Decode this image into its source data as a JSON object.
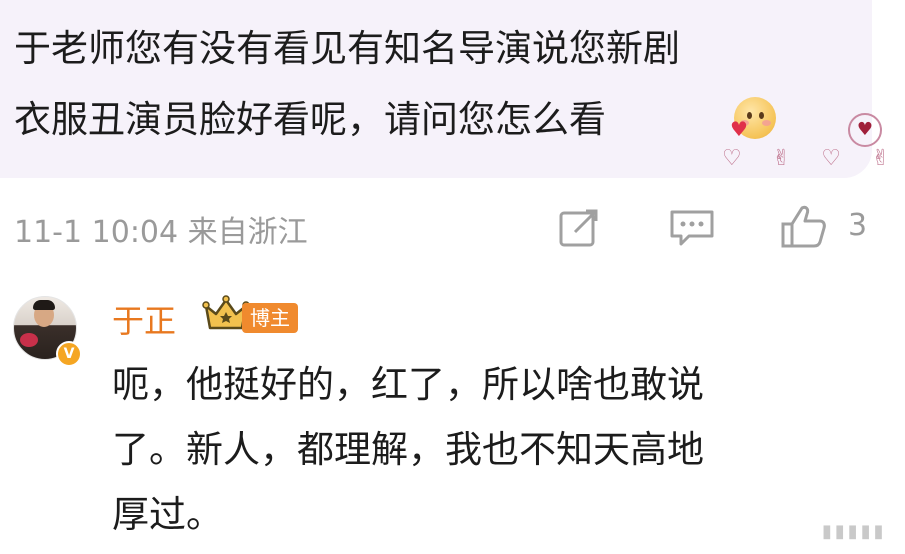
{
  "question": {
    "line1": "于老师您有没有看见有知名导演说您新剧",
    "line2": "衣服丑演员脸好看呢，请问您怎么看"
  },
  "meta": {
    "date": "11-1",
    "time": "10:04",
    "location": "来自浙江",
    "like_count": "3"
  },
  "reply": {
    "author": "于正",
    "tag": "博主",
    "verified": "V",
    "line1": "呃，他挺好的，红了，所以啥也敢说",
    "line2": "了。新人，都理解，我也不知天高地",
    "line3": "厚过。"
  },
  "colors": {
    "bubble_bg": "#f6f2fa",
    "author": "#e8781f",
    "tag_bg": "#f08a2e",
    "meta": "#9a9a9a"
  },
  "icons": [
    "emoji-blush-icon",
    "heart-badge-icon",
    "hand-gestures-icon",
    "repost-icon",
    "comment-icon",
    "like-icon",
    "verified-icon",
    "crown-icon"
  ]
}
